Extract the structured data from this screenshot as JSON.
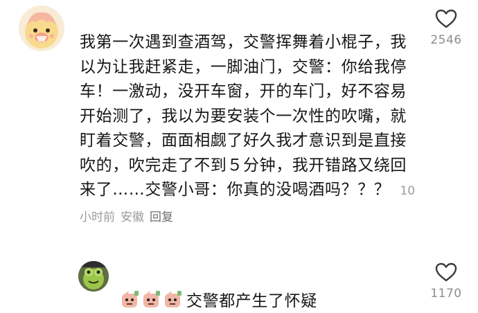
{
  "comments": [
    {
      "text": "我第一次遇到查酒驾，交警挥舞着小棍子，我以为让我赶紧走，一脚油门，交警：你给我停车！一激动，没开车窗，开的车门，好不容易开始测了，我以为要安装个一次性的吹嘴，就盯着交警，面面相觑了好久我才意识到是直接吹的，吹完走了不到５分钟，我开错路又绕回来了……交警小哥：你真的没喝酒吗？？？",
      "time": "10小时前",
      "location": "安徽",
      "reply_label": "回复",
      "likes": "2546",
      "avatar_icon": "cartoon-avatar-icon",
      "like_icon": "heart-outline-icon"
    },
    {
      "text": "交警都产生了怀疑",
      "stickers": [
        "doubt-sticker-icon",
        "doubt-sticker-icon",
        "doubt-sticker-icon"
      ],
      "likes": "1170",
      "avatar_icon": "frog-avatar-icon",
      "like_icon": "heart-outline-icon"
    }
  ]
}
